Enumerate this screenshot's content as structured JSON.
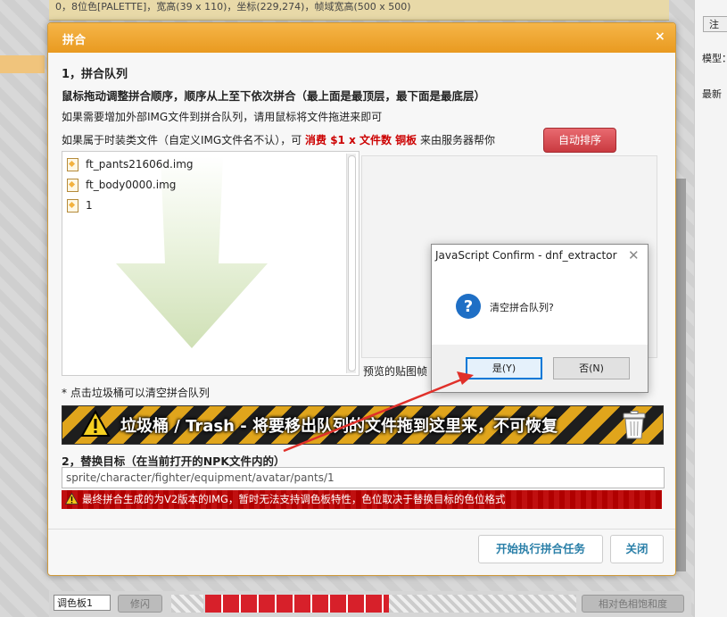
{
  "background": {
    "top_row": "0，8位色[PALETTE]，宽高(39 x 110)，坐标(229,274)，帧域宽高(500 x 500)",
    "right_button": "注",
    "right_label_1": "模型：",
    "right_label_2": "最新",
    "palette_select": "调色板1",
    "flash_button": "修闪",
    "hue_button": "相对色相饱和度"
  },
  "dialog": {
    "title": "拼合",
    "close": "×",
    "section1_title": "1，拼合队列",
    "section1_desc": "鼠标拖动调整拼合顺序，顺序从上至下依次拼合（最上面是最顶层，最下面是最底层）",
    "external_note": "如果需要增加外部IMG文件到拼合队列，请用鼠标将文件拖进来即可",
    "fashion_note_pre": "如果属于时装类文件（自定义IMG文件名不认），可",
    "fashion_note_cost": "消费 $1 x 文件数 铜板",
    "fashion_note_post": "来由服务器帮你",
    "auto_sort_button": "自动排序",
    "queue_items": [
      "ft_pants21606d.img",
      "ft_body0000.img",
      "1"
    ],
    "preview_label": "预览的贴图帧",
    "trash_note": "* 点击垃圾桶可以清空拼合队列",
    "trash_text": "垃圾桶 / Trash  - 将要移出队列的文件拖到这里来，不可恢复",
    "section2_title": "2，替换目标（在当前打开的NPK文件内的）",
    "target_value": "sprite/character/fighter/equipment/avatar/pants/1",
    "warning_text": "最终拼合生成的为V2版本的IMG，暂时无法支持调色板特性，色位取决于替换目标的色位格式",
    "start_button": "开始执行拼合任务",
    "close_button": "关闭"
  },
  "confirm": {
    "title": "JavaScript Confirm - dnf_extractor",
    "message": "清空拼合队列?",
    "yes_button": "是(Y)",
    "no_button": "否(N)"
  },
  "colors": {
    "header_orange": "#eea02c",
    "auto_sort_red": "#d9474d",
    "link_blue": "#2a7fa8",
    "warning_red": "#b80000",
    "confirm_blue": "#0078d7"
  }
}
